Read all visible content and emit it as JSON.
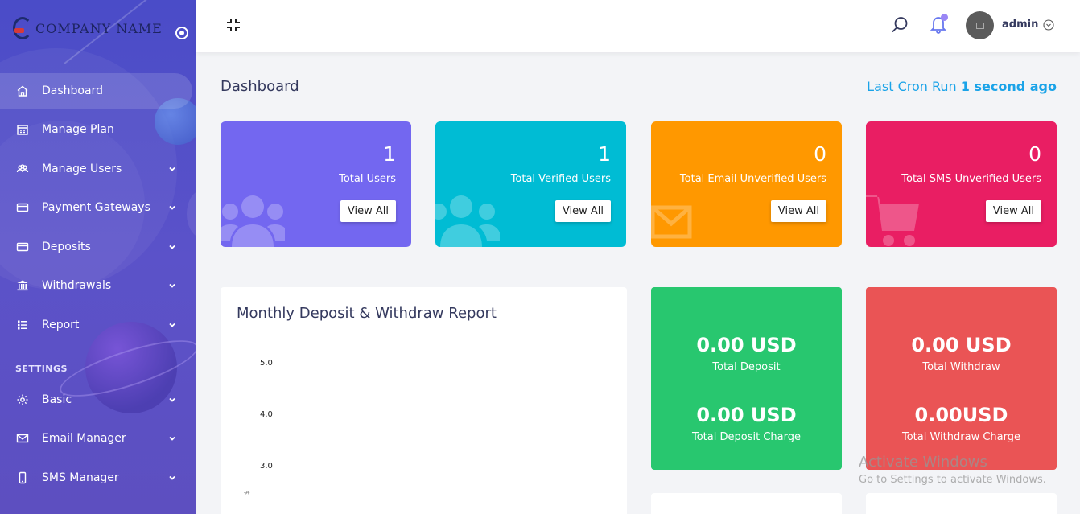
{
  "brand": {
    "name": "COMPANY NAME"
  },
  "sidebar": {
    "items": [
      {
        "label": "Dashboard",
        "icon": "home-icon",
        "active": true,
        "expandable": false
      },
      {
        "label": "Manage Plan",
        "icon": "plan-icon",
        "active": false,
        "expandable": false
      },
      {
        "label": "Manage Users",
        "icon": "users-icon",
        "active": false,
        "expandable": true
      },
      {
        "label": "Payment Gateways",
        "icon": "credit-card-icon",
        "active": false,
        "expandable": true
      },
      {
        "label": "Deposits",
        "icon": "credit-card-icon",
        "active": false,
        "expandable": true
      },
      {
        "label": "Withdrawals",
        "icon": "bank-icon",
        "active": false,
        "expandable": true
      },
      {
        "label": "Report",
        "icon": "list-icon",
        "active": false,
        "expandable": true
      }
    ],
    "section_settings": "SETTINGS",
    "settings_items": [
      {
        "label": "Basic",
        "icon": "gear-icon",
        "expandable": true
      },
      {
        "label": "Email Manager",
        "icon": "envelope-icon",
        "expandable": true
      },
      {
        "label": "SMS Manager",
        "icon": "mobile-icon",
        "expandable": true
      }
    ]
  },
  "header": {
    "user": "admin"
  },
  "main": {
    "title": "Dashboard",
    "cron_prefix": "Last Cron Run",
    "cron_value": "1 second ago",
    "stats": [
      {
        "value": "1",
        "label": "Total Users",
        "button": "View All",
        "color": "#7367f0"
      },
      {
        "value": "1",
        "label": "Total Verified Users",
        "button": "View All",
        "color": "#00bcd4"
      },
      {
        "value": "0",
        "label": "Total Email Unverified Users",
        "button": "View All",
        "color": "#ff9800"
      },
      {
        "value": "0",
        "label": "Total SMS Unverified Users",
        "button": "View All",
        "color": "#e91e63"
      }
    ],
    "chart_card": {
      "title": "Monthly Deposit & Withdraw Report",
      "ticks": [
        "5.0",
        "4.0",
        "3.0"
      ],
      "axis_symbol": "$"
    },
    "deposit_card": {
      "amount": "0.00 USD",
      "label": "Total Deposit",
      "charge_amount": "0.00 USD",
      "charge_label": "Total Deposit Charge",
      "color": "#28c76f"
    },
    "withdraw_card": {
      "amount": "0.00 USD",
      "label": "Total Withdraw",
      "charge_amount": "0.00USD",
      "charge_label": "Total Withdraw Charge",
      "color": "#ea5455"
    }
  },
  "watermark": {
    "line1": "Activate Windows",
    "line2": "Go to Settings to activate Windows."
  },
  "chart_data": {
    "type": "bar",
    "title": "Monthly Deposit & Withdraw Report",
    "xlabel": "",
    "ylabel": "$",
    "y_ticks": [
      5.0,
      4.0,
      3.0
    ],
    "categories": [],
    "series": []
  }
}
